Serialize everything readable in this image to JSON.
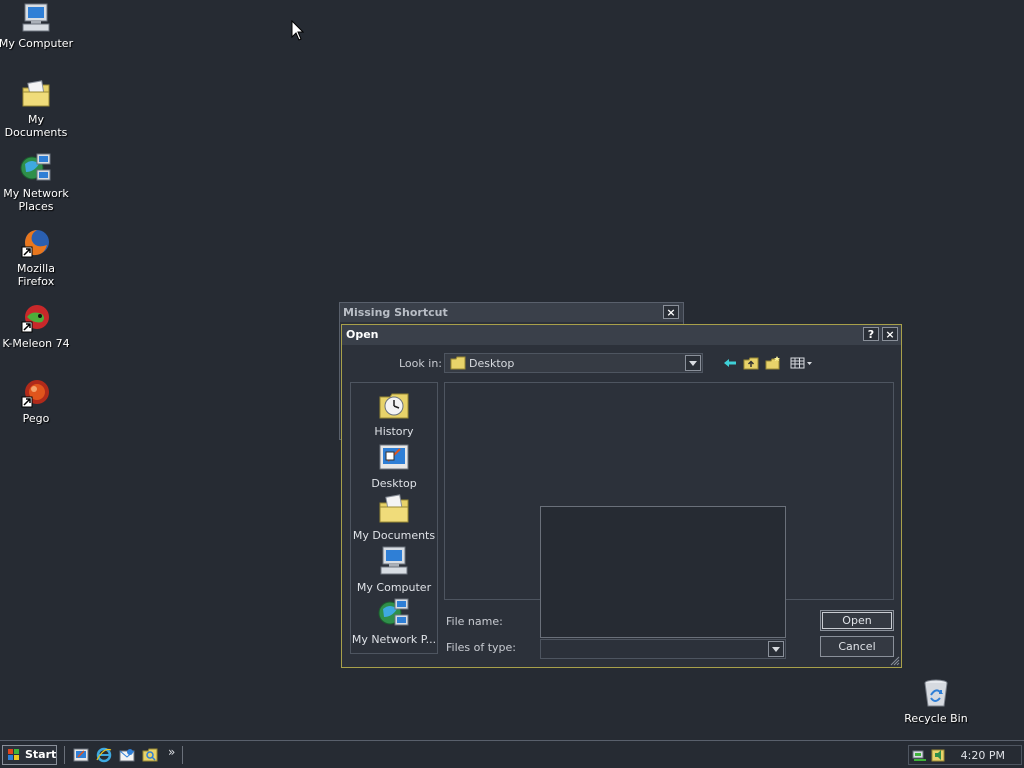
{
  "desktop": {
    "icons": [
      {
        "label": "My Computer",
        "icon": "my-computer-icon"
      },
      {
        "label": "My Documents",
        "icon": "my-documents-icon"
      },
      {
        "label": "My Network",
        "label2": "Places",
        "icon": "network-places-icon"
      },
      {
        "label": "Mozilla Firefox",
        "icon": "firefox-icon"
      },
      {
        "label": "K-Meleon 74",
        "icon": "k-meleon-icon"
      },
      {
        "label": "Pego",
        "icon": "pego-icon"
      },
      {
        "label": "Recycle Bin",
        "icon": "recycle-bin-icon"
      }
    ]
  },
  "missing_shortcut": {
    "title": "Missing Shortcut",
    "close_label": "×"
  },
  "open_dialog": {
    "title": "Open",
    "help_label": "?",
    "close_label": "×",
    "look_in_label": "Look in:",
    "look_in_value": "Desktop",
    "places": [
      {
        "label": "History",
        "icon": "history-icon"
      },
      {
        "label": "Desktop",
        "icon": "desktop-icon"
      },
      {
        "label": "My Documents",
        "icon": "my-documents-icon"
      },
      {
        "label": "My Computer",
        "icon": "my-computer-icon"
      },
      {
        "label": "My Network P...",
        "icon": "network-places-icon"
      }
    ],
    "file_name_label": "File name:",
    "file_name_value": "",
    "files_of_type_label": "Files of type:",
    "files_of_type_value": "",
    "open_button": "Open",
    "cancel_button": "Cancel"
  },
  "taskbar": {
    "start_label": "Start",
    "chevron": "»",
    "clock": "4:20 PM"
  },
  "colors": {
    "desktop_bg": "#262b33",
    "window_bg": "#2c313a",
    "dialog_border": "#a8a04a",
    "folder_yellow": "#e8d36a",
    "back_arrow": "#3fd1d8"
  }
}
